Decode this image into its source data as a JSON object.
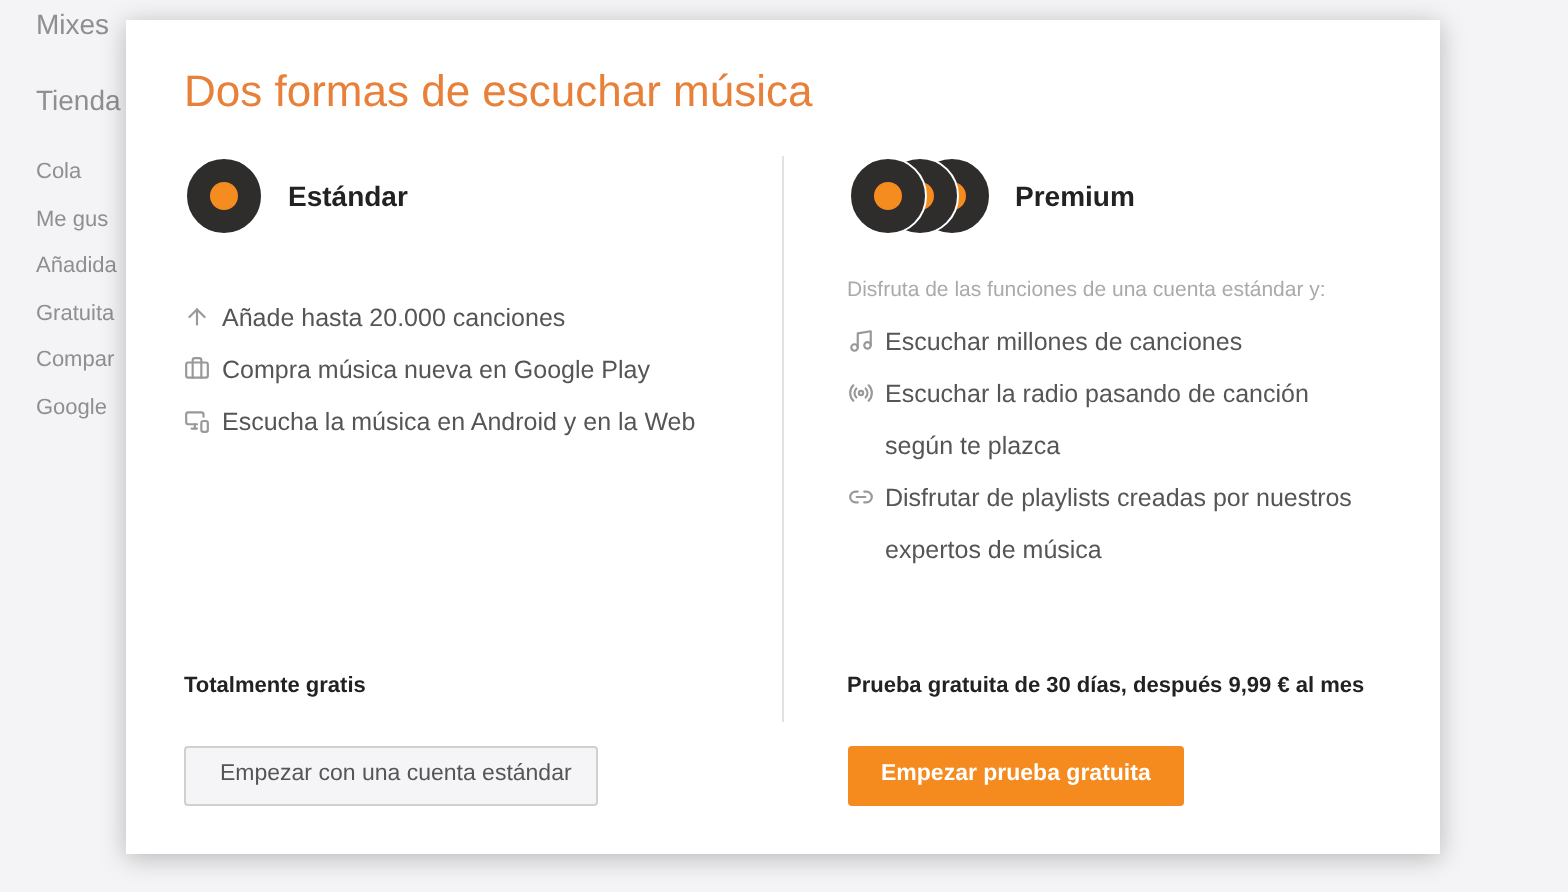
{
  "sidebar": {
    "items": [
      "Mixes",
      "Tienda",
      "Cola",
      "Me gus",
      "Añadida",
      "Gratuita",
      "Compar",
      "Google"
    ]
  },
  "dialog": {
    "title": "Dos formas de escuchar música",
    "plans": [
      {
        "kind": "standard",
        "name": "Estándar",
        "features": [
          "Añade hasta 20.000 canciones",
          "Compra música nueva en Google Play",
          "Escucha la música en Android y en la Web"
        ],
        "price": "Totalmente gratis",
        "button": "Empezar con una cuenta estándar"
      },
      {
        "kind": "premium",
        "name": "Premium",
        "intro": "Disfruta de las funciones de una cuenta estándar y:",
        "features": [
          "Escuchar millones de canciones",
          "Escuchar la radio pasando de canción según te plazca",
          "Disfrutar de playlists creadas por nuestros expertos de música"
        ],
        "price": "Prueba gratuita de 30 días, después 9,99 € al mes",
        "button": "Empezar prueba gratuita"
      }
    ]
  }
}
